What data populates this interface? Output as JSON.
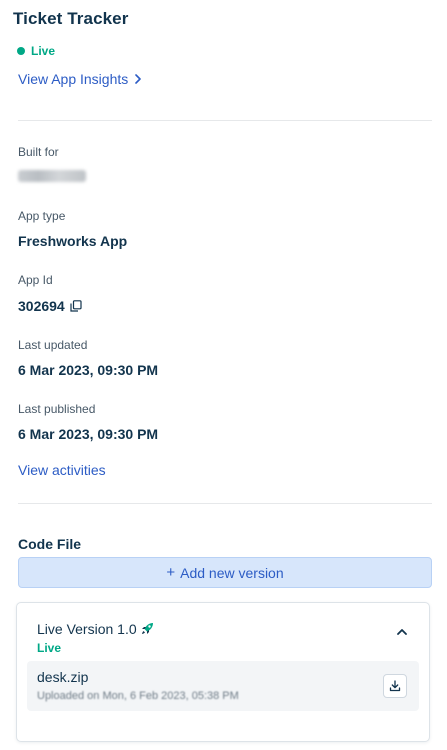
{
  "app": {
    "title": "Ticket Tracker",
    "status": "Live",
    "insights_link": "View App Insights"
  },
  "details": {
    "built_for_label": "Built for",
    "app_type_label": "App type",
    "app_type_value": "Freshworks App",
    "app_id_label": "App Id",
    "app_id_value": "302694",
    "last_updated_label": "Last updated",
    "last_updated_value": "6 Mar 2023, 09:30 PM",
    "last_published_label": "Last published",
    "last_published_value": "6 Mar 2023, 09:30 PM",
    "activities_link": "View activities"
  },
  "code_file": {
    "title": "Code File",
    "add_version_label": "Add new version",
    "version": {
      "title": "Live Version 1.0",
      "status": "Live",
      "file_name": "desk.zip",
      "file_meta": "Uploaded on Mon, 6 Feb 2023, 05:38 PM"
    }
  },
  "colors": {
    "live_green": "#00a886",
    "link_blue": "#2c5cc5",
    "button_bg": "#d7e6fb"
  },
  "icons": [
    "chevron-right-icon",
    "copy-icon",
    "plus-icon",
    "rocket-icon",
    "chevron-up-icon",
    "download-icon"
  ]
}
